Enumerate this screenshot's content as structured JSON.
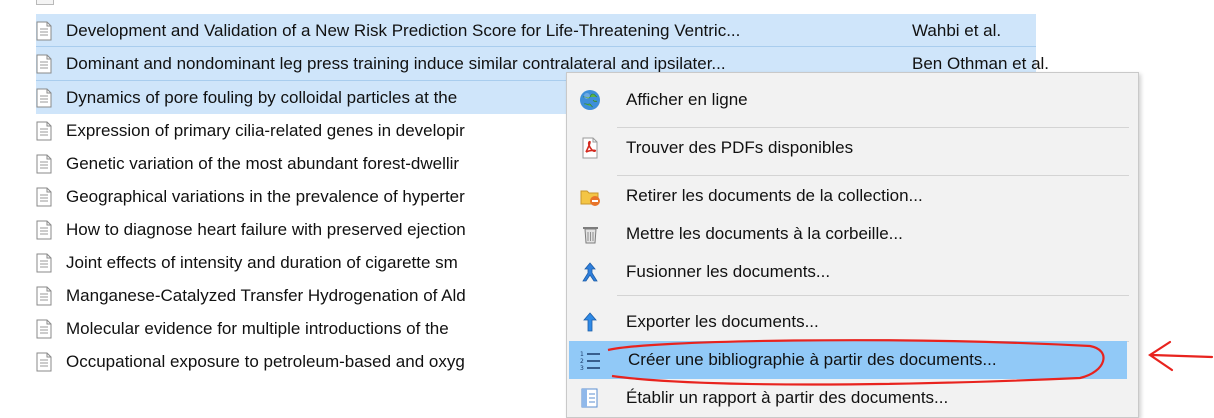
{
  "documents": [
    {
      "title": "Development and Validation of a New Risk Prediction Score for Life-Threatening Ventric...",
      "author": "Wahbi et al.",
      "selected": true
    },
    {
      "title": "Dominant and nondominant leg press training induce similar contralateral and ipsilater...",
      "author": "Ben Othman et al.",
      "selected": true
    },
    {
      "title": "Dynamics of pore fouling by colloidal particles at the",
      "author": "",
      "selected": true
    },
    {
      "title": "Expression of primary cilia-related genes in developir",
      "author": "",
      "selected": false
    },
    {
      "title": "Genetic variation of the most abundant forest-dwellir",
      "author": "",
      "selected": false
    },
    {
      "title": "Geographical variations in the prevalence of hyperter",
      "author": "",
      "selected": false
    },
    {
      "title": "How to diagnose heart failure with preserved ejection",
      "author": "",
      "selected": false
    },
    {
      "title": "Joint effects of intensity and duration of cigarette sm",
      "author": "",
      "selected": false
    },
    {
      "title": "Manganese-Catalyzed Transfer Hydrogenation of Ald",
      "author": "",
      "selected": false
    },
    {
      "title": "Molecular evidence for multiple introductions of the",
      "author": "",
      "selected": false
    },
    {
      "title": "Occupational exposure to petroleum-based and oxyg",
      "author": "",
      "selected": false
    }
  ],
  "context_menu": {
    "items": [
      {
        "label": "Afficher en ligne",
        "icon": "globe-icon"
      },
      {
        "label": "Trouver des PDFs disponibles",
        "icon": "pdf-icon"
      },
      {
        "label": "Retirer les documents de la collection...",
        "icon": "folder-remove-icon"
      },
      {
        "label": "Mettre les documents à la corbeille...",
        "icon": "trash-icon"
      },
      {
        "label": "Fusionner les documents...",
        "icon": "merge-icon"
      },
      {
        "label": "Exporter les documents...",
        "icon": "export-icon"
      },
      {
        "label": "Créer une bibliographie à partir des documents...",
        "icon": "bibliography-icon",
        "highlighted": true
      },
      {
        "label": "Établir un rapport à partir des documents...",
        "icon": "report-icon"
      }
    ]
  },
  "colors": {
    "selection": "#cfe5fa",
    "menu_hover": "#91c9f7",
    "annotation": "#e8231e"
  }
}
